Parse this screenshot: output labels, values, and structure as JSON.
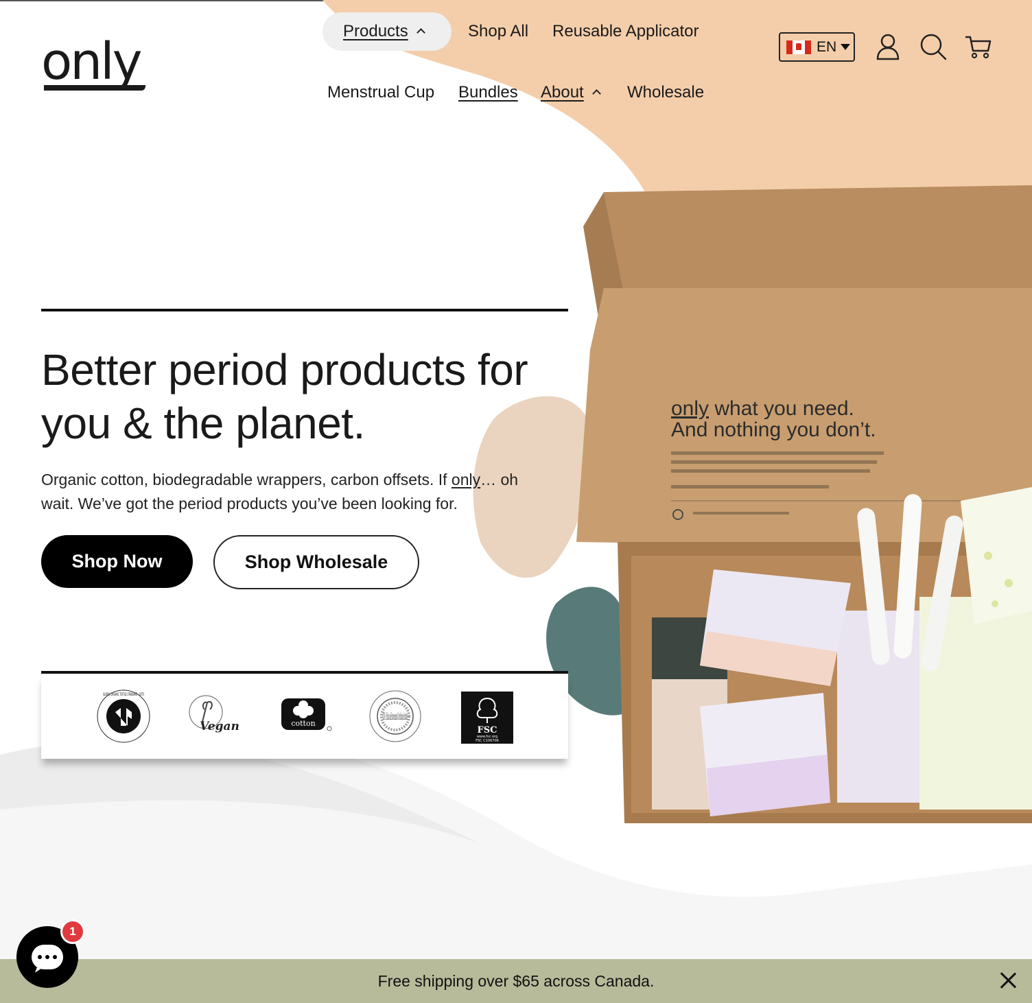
{
  "header": {
    "logo_text": "only",
    "nav_row1": [
      {
        "label": "Products",
        "active": true
      },
      {
        "label": "Shop All"
      },
      {
        "label": "Reusable Applicator"
      }
    ],
    "nav_row2": [
      {
        "label": "Menstrual Cup"
      },
      {
        "label": "Bundles"
      },
      {
        "label": "About"
      },
      {
        "label": "Wholesale"
      }
    ],
    "language": "EN",
    "icons": [
      "account-icon",
      "search-icon",
      "cart-icon"
    ]
  },
  "hero": {
    "headline": "Better period products for you & the planet.",
    "subtext_before": "Organic cotton, biodegradable wrappers, carbon offsets. If ",
    "subtext_link": "only",
    "subtext_after": "… oh wait. We’ve got the period products you’ve been looking for.",
    "primary_button": "Shop Now",
    "secondary_button": "Shop Wholesale"
  },
  "certifications": {
    "gots": "GLOBAL ORGANIC TEXTILE STANDARD · GOTS",
    "vegan": "Vegan",
    "cotton": "cotton",
    "icea": "ICEA · Ethical and Environmental Certification Institute",
    "fsc": "FSC",
    "fsc_site": "www.fsc.org",
    "fsc_code": "FSC C106706"
  },
  "product_box": {
    "brand": "only",
    "line1": " what you need.",
    "line2": "And nothing you don’t."
  },
  "banner": {
    "text": "Free shipping over $65 across Canada."
  },
  "chat": {
    "badge_count": "1"
  },
  "colors": {
    "peach": "#f4ceaa",
    "banner": "#b7bb9a",
    "badge": "#e03a3e",
    "box": "#c49a6c"
  }
}
